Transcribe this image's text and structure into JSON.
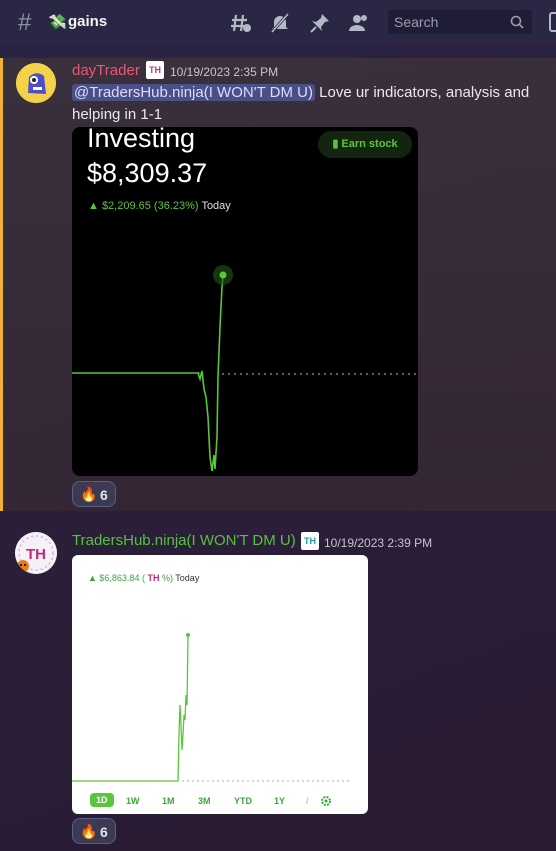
{
  "header": {
    "channel_emoji": "💸",
    "channel_name": "gains",
    "search_placeholder": "Search"
  },
  "messages": [
    {
      "username": "dayTrader",
      "badge": "TH",
      "timestamp": "10/19/2023 2:35 PM",
      "mention": "@TradersHub.ninja(I WON'T DM U)",
      "text": " Love ur indicators, analysis and helping in 1-1",
      "image": {
        "title": "Investing",
        "value": "$8,309.37",
        "change": "▲ $2,209.65 (36.23%)",
        "period": "Today",
        "earn_button": "Earn stock"
      },
      "reaction": {
        "emoji": "🔥",
        "count": "6"
      }
    },
    {
      "username": "TradersHub.ninja(I WON'T DM U)",
      "badge": "TH",
      "timestamp": "10/19/2023 2:39 PM",
      "image": {
        "change_prefix": "▲ $6,863.84 (",
        "change_suffix": "%)",
        "period": "Today",
        "tabs": [
          "1D",
          "1W",
          "1M",
          "3M",
          "YTD",
          "1Y",
          "/"
        ]
      },
      "reaction": {
        "emoji": "🔥",
        "count": "6"
      }
    }
  ],
  "colors": {
    "accent_green": "#5ac53b",
    "username_pink": "#e8577a",
    "username_green": "#57c23f",
    "highlight_border": "#f0b232"
  }
}
